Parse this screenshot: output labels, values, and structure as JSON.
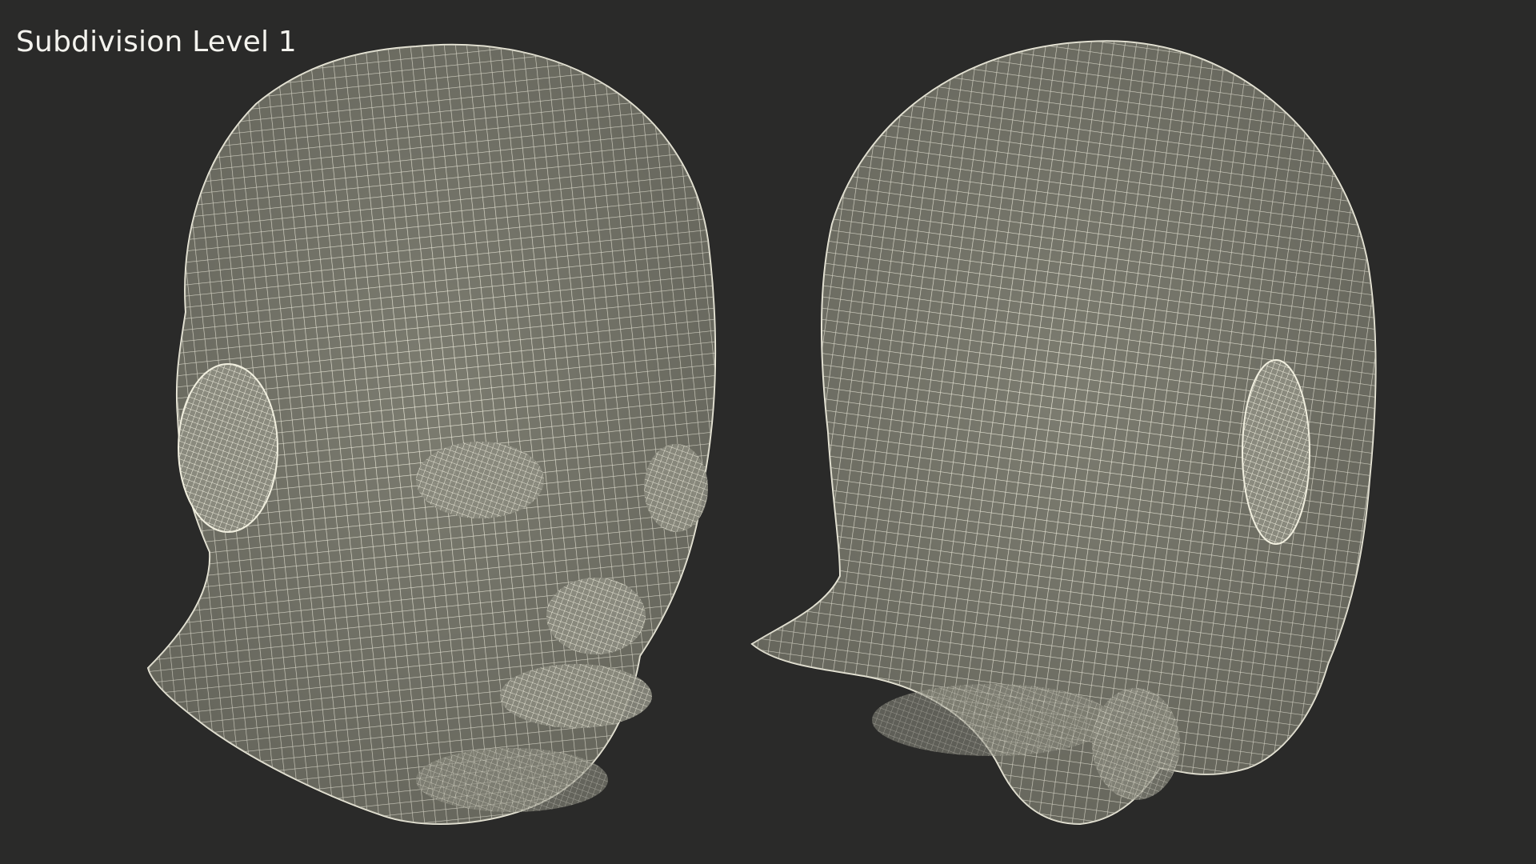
{
  "overlay": {
    "label": "Subdivision Level 1"
  },
  "colors": {
    "background": "#2a2a29",
    "mesh_fill": "#7c7c70",
    "wire": "#f1efdf",
    "label": "#f4f3ee"
  },
  "views": [
    {
      "name": "front-three-quarter",
      "depicts": "wireframe-head-front-view"
    },
    {
      "name": "rear-three-quarter",
      "depicts": "wireframe-head-back-view"
    }
  ]
}
